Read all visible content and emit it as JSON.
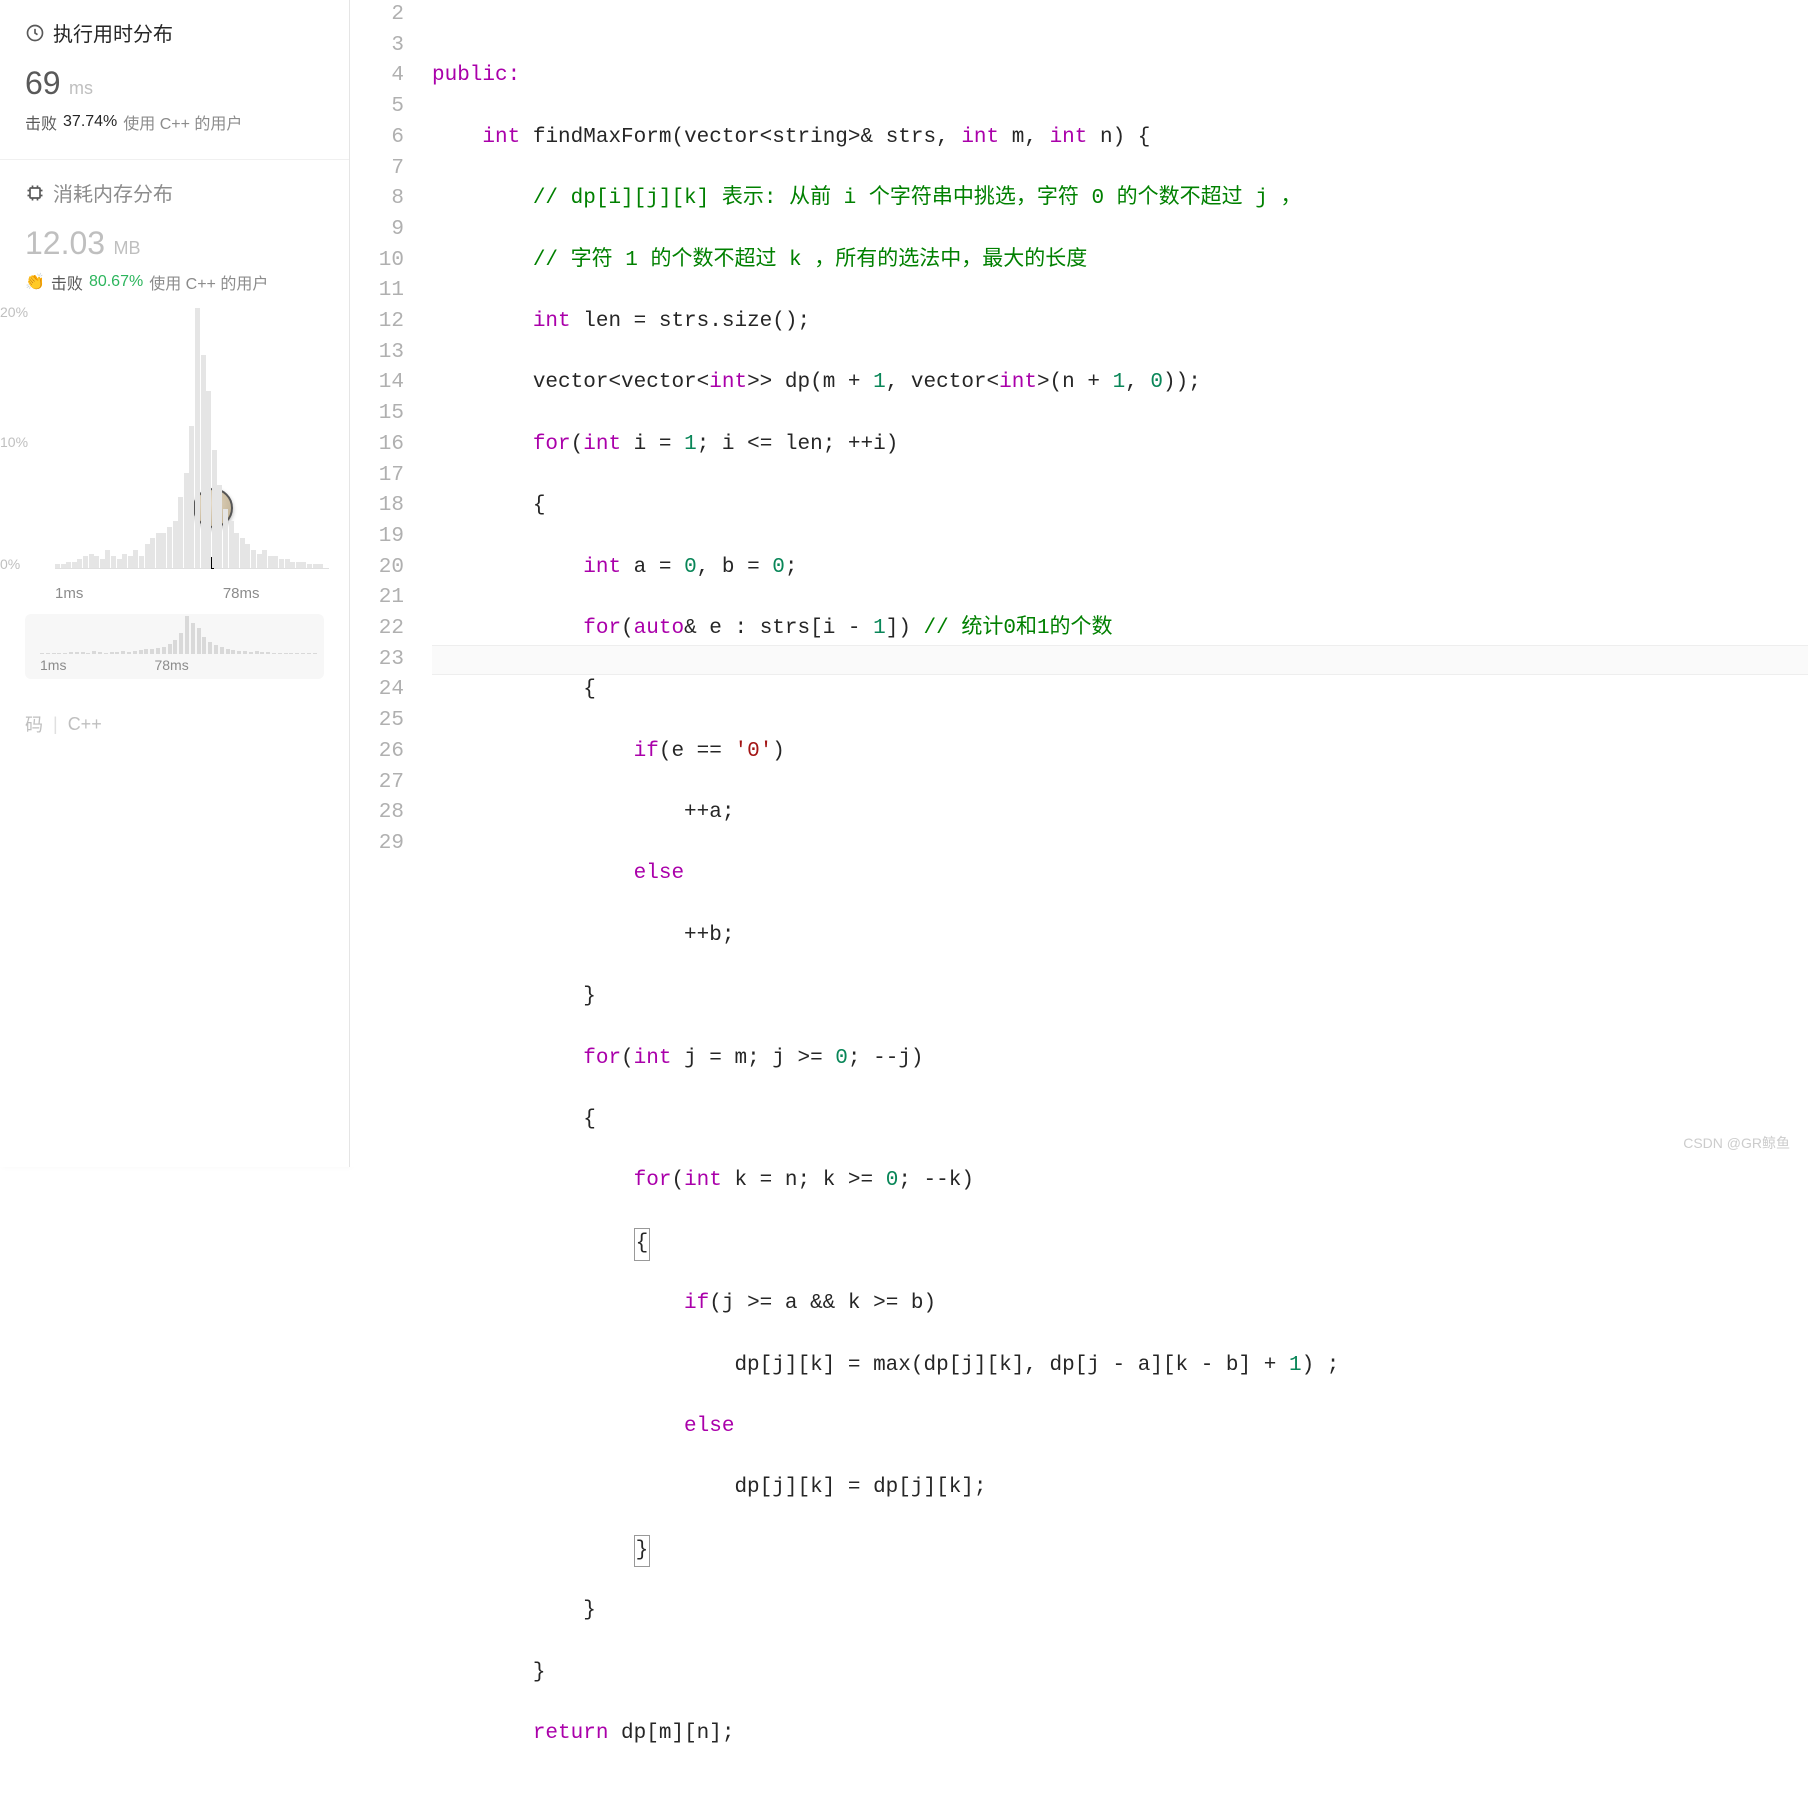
{
  "sidebar": {
    "runtime": {
      "title": "执行用时分布",
      "value": "69",
      "unit": "ms",
      "beat_label": "击败",
      "beat_pct": "37.74%",
      "beat_suffix": "使用 C++ 的用户"
    },
    "memory": {
      "title": "消耗内存分布",
      "value": "12.03",
      "unit": "MB",
      "beat_label": "击败",
      "beat_pct": "80.67%",
      "beat_suffix": "使用 C++ 的用户"
    },
    "chart": {
      "y_labels": [
        "20%",
        "10%",
        "0%"
      ],
      "x_min": "1ms",
      "x_mid": "78ms"
    },
    "mini_chart": {
      "x_min": "1ms",
      "x_mid": "78ms"
    },
    "bottom": {
      "left": "码",
      "lang": "C++"
    }
  },
  "code": {
    "lines": [
      2,
      3,
      4,
      5,
      6,
      7,
      8,
      9,
      10,
      11,
      12,
      13,
      14,
      15,
      16,
      17,
      18,
      19,
      20,
      21,
      22,
      23,
      24,
      25,
      26,
      27,
      28,
      29
    ],
    "highlighted_line": 23,
    "l2": "public:",
    "l3_kw1": "int",
    "l3_fn": "findMaxForm",
    "l3_p": "(vector<string>& strs, ",
    "l3_kw2": "int",
    "l3_p2": " m, ",
    "l3_kw3": "int",
    "l3_p3": " n) {",
    "l4": "// dp[i][j][k] 表示: 从前 i 个字符串中挑选，字符 0 的个数不超过 j ，",
    "l5": "// 字符 1 的个数不超过 k ，所有的选法中，最大的长度",
    "l6_kw": "int",
    "l6_rest": " len = strs.size();",
    "l7_a": "vector<vector<",
    "l7_kw": "int",
    "l7_b": ">> dp(m + ",
    "l7_n1": "1",
    "l7_c": ", vector<",
    "l7_kw2": "int",
    "l7_d": ">(n + ",
    "l7_n2": "1",
    "l7_e": ", ",
    "l7_n3": "0",
    "l7_f": "));",
    "l8_kw": "for",
    "l8_a": "(",
    "l8_kw2": "int",
    "l8_b": " i = ",
    "l8_n": "1",
    "l8_c": "; i <= len; ++i)",
    "l9": "{",
    "l10_kw": "int",
    "l10_a": " a = ",
    "l10_n1": "0",
    "l10_b": ", b = ",
    "l10_n2": "0",
    "l10_c": ";",
    "l11_kw": "for",
    "l11_a": "(",
    "l11_kw2": "auto",
    "l11_b": "& e : strs[i - ",
    "l11_n": "1",
    "l11_c": "]) ",
    "l11_cmt": "// 统计0和1的个数",
    "l12": "{",
    "l13_kw": "if",
    "l13_a": "(e == ",
    "l13_s": "'0'",
    "l13_b": ")",
    "l14": "++a;",
    "l15": "else",
    "l16": "++b;",
    "l17": "}",
    "l18_kw": "for",
    "l18_a": "(",
    "l18_kw2": "int",
    "l18_b": " j = m; j >= ",
    "l18_n": "0",
    "l18_c": "; --j)",
    "l19": "{",
    "l20_kw": "for",
    "l20_a": "(",
    "l20_kw2": "int",
    "l20_b": " k = n; k >= ",
    "l20_n": "0",
    "l20_c": "; --k)",
    "l21": "{",
    "l22_kw": "if",
    "l22_a": "(j >= a && k >= b)",
    "l23": "dp[j][k] = max(dp[j][k], dp[j - a][k - b] + ",
    "l23_n": "1",
    "l23_b": ") ;",
    "l24": "else",
    "l25": "dp[j][k] = dp[j][k];",
    "l26": "}",
    "l27": "}",
    "l28": "}",
    "l29_kw": "return",
    "l29_a": " dp[m][n];"
  },
  "chart_data": {
    "type": "bar",
    "title": "执行用时分布",
    "xlabel": "ms",
    "ylabel": "%",
    "ylim": [
      0,
      22
    ],
    "x_range": [
      "1ms",
      "78ms"
    ],
    "user_position": "78ms",
    "bars_approx_heights_pct": [
      0.3,
      0.3,
      0.5,
      0.5,
      0.8,
      1,
      1.2,
      1,
      0.8,
      1.5,
      1,
      0.8,
      1.2,
      1,
      1.5,
      1,
      2,
      2.5,
      3,
      3,
      3.5,
      4,
      6,
      8,
      12,
      22,
      18,
      15,
      10,
      7,
      5,
      4,
      3,
      2.5,
      2,
      1.5,
      1.2,
      1.5,
      1,
      1,
      0.8,
      0.8,
      0.5,
      0.5,
      0.5,
      0.3,
      0.3,
      0.3
    ]
  },
  "watermark": "CSDN @GR鲸鱼"
}
